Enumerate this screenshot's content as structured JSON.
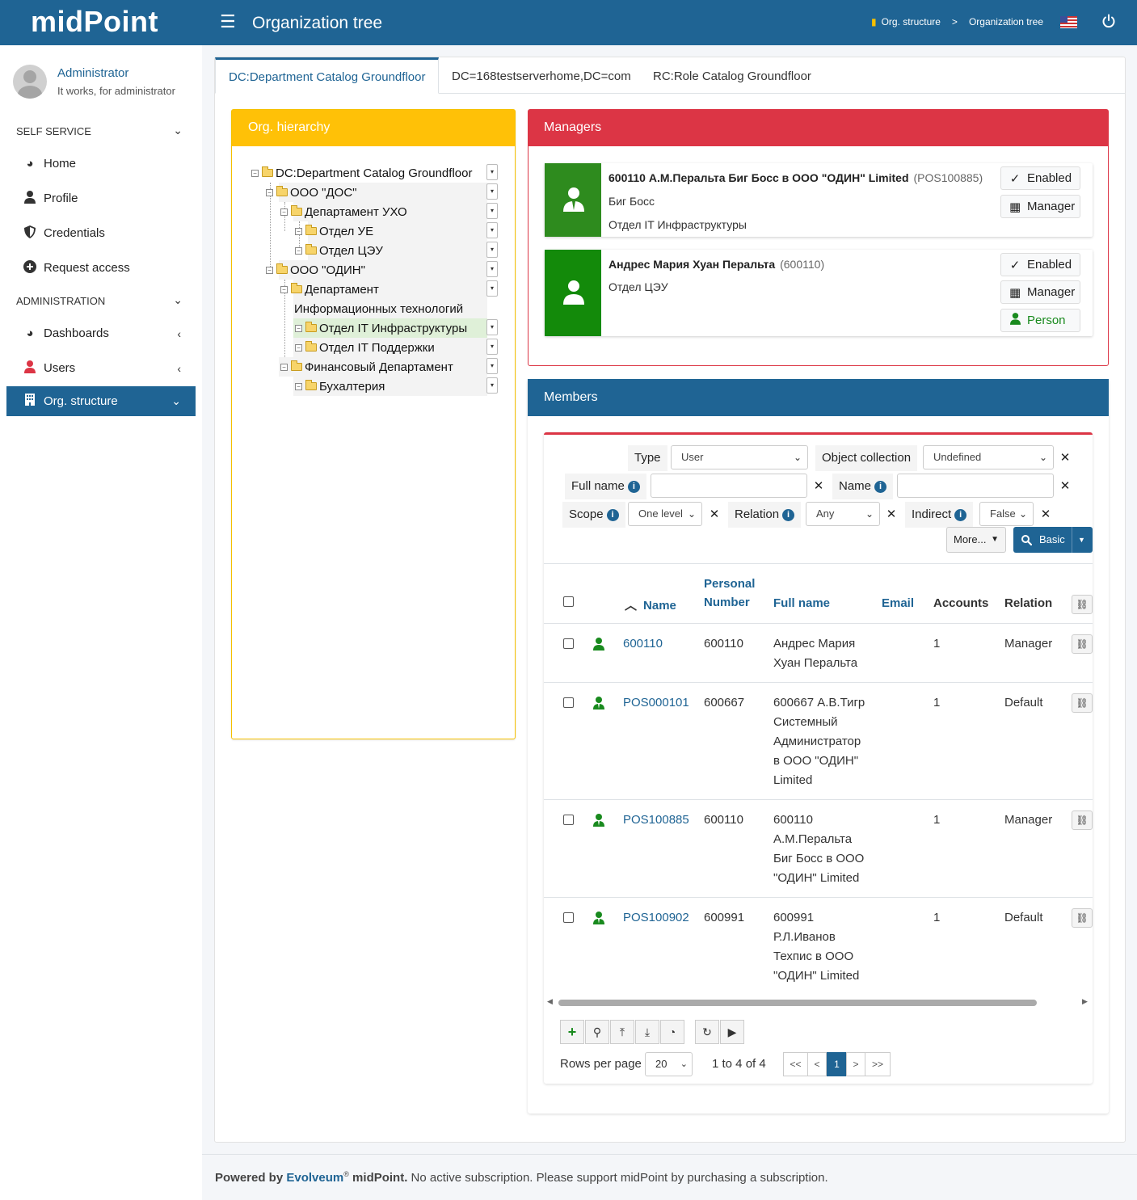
{
  "header": {
    "logo": "midPoint",
    "title": "Organization tree",
    "breadcrumb": [
      "Org. structure",
      ">",
      "Organization tree"
    ]
  },
  "user": {
    "name": "Administrator",
    "subtitle": "It works, for administrator"
  },
  "sidebar": {
    "self_service": "SELF SERVICE",
    "administration": "ADMINISTRATION",
    "items": [
      {
        "label": "Home",
        "icon": "dashboard-icon"
      },
      {
        "label": "Profile",
        "icon": "user-icon"
      },
      {
        "label": "Credentials",
        "icon": "shield-icon"
      },
      {
        "label": "Request access",
        "icon": "plus-circle-icon"
      },
      {
        "label": "Dashboards",
        "icon": "dashboard-icon"
      },
      {
        "label": "Users",
        "icon": "user-icon"
      },
      {
        "label": "Org. structure",
        "icon": "building-icon"
      }
    ]
  },
  "tabs": [
    "DC:Department Catalog Groundfloor",
    "DC=168testserverhome,DC=com",
    "RC:Role Catalog Groundfloor"
  ],
  "org_hierarchy": {
    "title": "Org. hierarchy",
    "nodes": [
      "DC:Department Catalog Groundfloor",
      "ООО \"ДОС\"",
      "Департамент УХО",
      "Отдел УЕ",
      "Отдел ЦЭУ",
      "ООО \"ОДИН\"",
      "Департамент",
      "Информационных технологий",
      "Отдел IT Инфраструктуры",
      "Отдел IT Поддержки",
      "Финансовый Департамент",
      "Бухалтерия"
    ]
  },
  "managers": {
    "title": "Managers",
    "cards": [
      {
        "name": "600110 А.М.Перальта Биг Босс в ООО \"ОДИН\" Limited",
        "oid": "(POS100885)",
        "line1": "Биг Босс",
        "line2": "Отдел IT Инфраструктуры",
        "buttons": [
          "Enabled",
          "Manager"
        ]
      },
      {
        "name": "Андрес Мария Хуан Перальта",
        "oid": "(600110)",
        "line1": "Отдел ЦЭУ",
        "buttons": [
          "Enabled",
          "Manager",
          "Person"
        ]
      }
    ]
  },
  "members": {
    "title": "Members",
    "filters": {
      "type_label": "Type",
      "type_value": "User",
      "collection_label": "Object collection",
      "collection_value": "Undefined",
      "fullname_label": "Full name",
      "name_label": "Name",
      "scope_label": "Scope",
      "scope_value": "One level",
      "relation_label": "Relation",
      "relation_value": "Any",
      "indirect_label": "Indirect",
      "indirect_value": "False",
      "more_label": "More...",
      "basic_label": "Basic"
    },
    "columns": {
      "name": "Name",
      "personal_number_1": "Personal",
      "personal_number_2": "Number",
      "full_name": "Full name",
      "email": "Email",
      "accounts": "Accounts",
      "relation": "Relation"
    },
    "rows": [
      {
        "name": "600110",
        "number": "600110",
        "full": [
          "Андрес Мария",
          "Хуан Перальта"
        ],
        "accounts": "1",
        "relation": "Manager"
      },
      {
        "name": "POS000101",
        "number": "600667",
        "full": [
          "600667 А.В.Тигр",
          "Системный",
          "Администратор",
          "в ООО \"ОДИН\"",
          "Limited"
        ],
        "accounts": "1",
        "relation": "Default"
      },
      {
        "name": "POS100885",
        "number": "600110",
        "full": [
          "600110",
          "А.М.Перальта",
          "Биг Босс в ООО",
          "\"ОДИН\" Limited"
        ],
        "accounts": "1",
        "relation": "Manager"
      },
      {
        "name": "POS100902",
        "number": "600991",
        "full": [
          "600991",
          "Р.Л.Иванов",
          "Техпис в ООО",
          "\"ОДИН\" Limited"
        ],
        "accounts": "1",
        "relation": "Default"
      }
    ],
    "paging": {
      "rows_label": "Rows per page",
      "rows_value": "20",
      "count": "1 to 4 of 4",
      "buttons": [
        "<<",
        "<",
        "1",
        ">",
        ">>"
      ]
    }
  },
  "footer": {
    "powered": "Powered by",
    "brand": "Evolveum",
    "reg": "®",
    "product": " midPoint.",
    "text": " No active subscription. Please support midPoint by purchasing a subscription."
  },
  "colors": {
    "primary": "#1f6494",
    "warning": "#ffc107",
    "danger": "#dc3545",
    "success": "#198a1e"
  }
}
